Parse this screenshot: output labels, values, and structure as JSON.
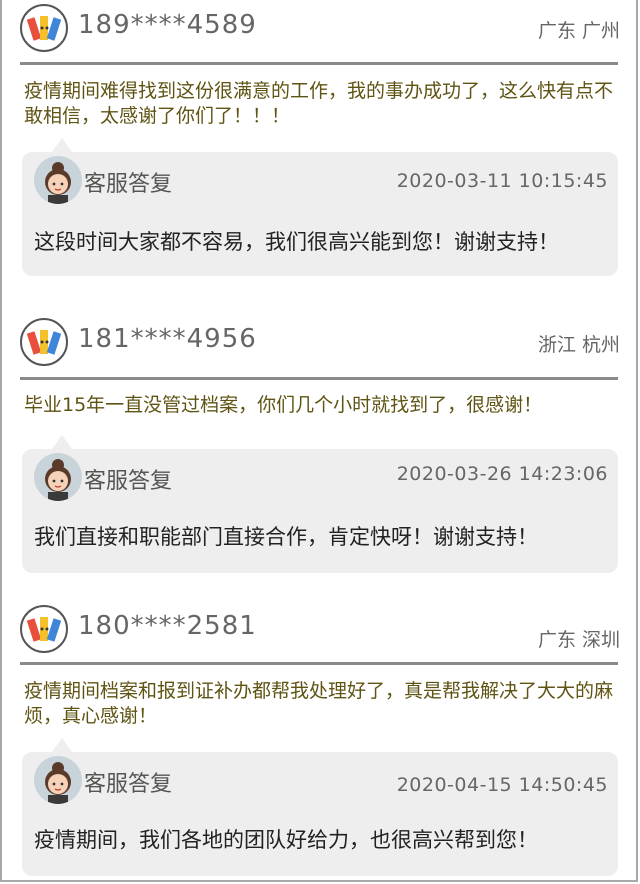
{
  "reviews": [
    {
      "phone": "189****4589",
      "location": "广东 广州",
      "comment": "疫情期间难得找到这份很满意的工作，我的事办成功了，这么快有点不敢相信，太感谢了你们了！！！",
      "reply": {
        "title": "客服答复",
        "time": "2020-03-11 10:15:45",
        "text": "这段时间大家都不容易，我们很高兴能到您！谢谢支持！"
      }
    },
    {
      "phone": "181****4956",
      "location": "浙江 杭州",
      "comment": "毕业15年一直没管过档案，你们几个小时就找到了，很感谢！",
      "reply": {
        "title": "客服答复",
        "time": "2020-03-26 14:23:06",
        "text": "我们直接和职能部门直接合作，肯定快呀！谢谢支持！"
      }
    },
    {
      "phone": "180****2581",
      "location": "广东 深圳",
      "comment": "疫情期间档案和报到证补办都帮我处理好了，真是帮我解决了大大的麻烦，真心感谢！",
      "reply": {
        "title": "客服答复",
        "time": "2020-04-15 14:50:45",
        "text": "疫情期间，我们各地的团队好给力，也很高兴帮到您！"
      }
    }
  ],
  "colors": {
    "comment_text": "#5f5413",
    "reply_bg": "#eeeeee",
    "divider": "#8a8a8a"
  },
  "icons": {
    "user_avatar": "pencils-avatar-icon",
    "service_avatar": "customer-service-avatar-icon"
  }
}
